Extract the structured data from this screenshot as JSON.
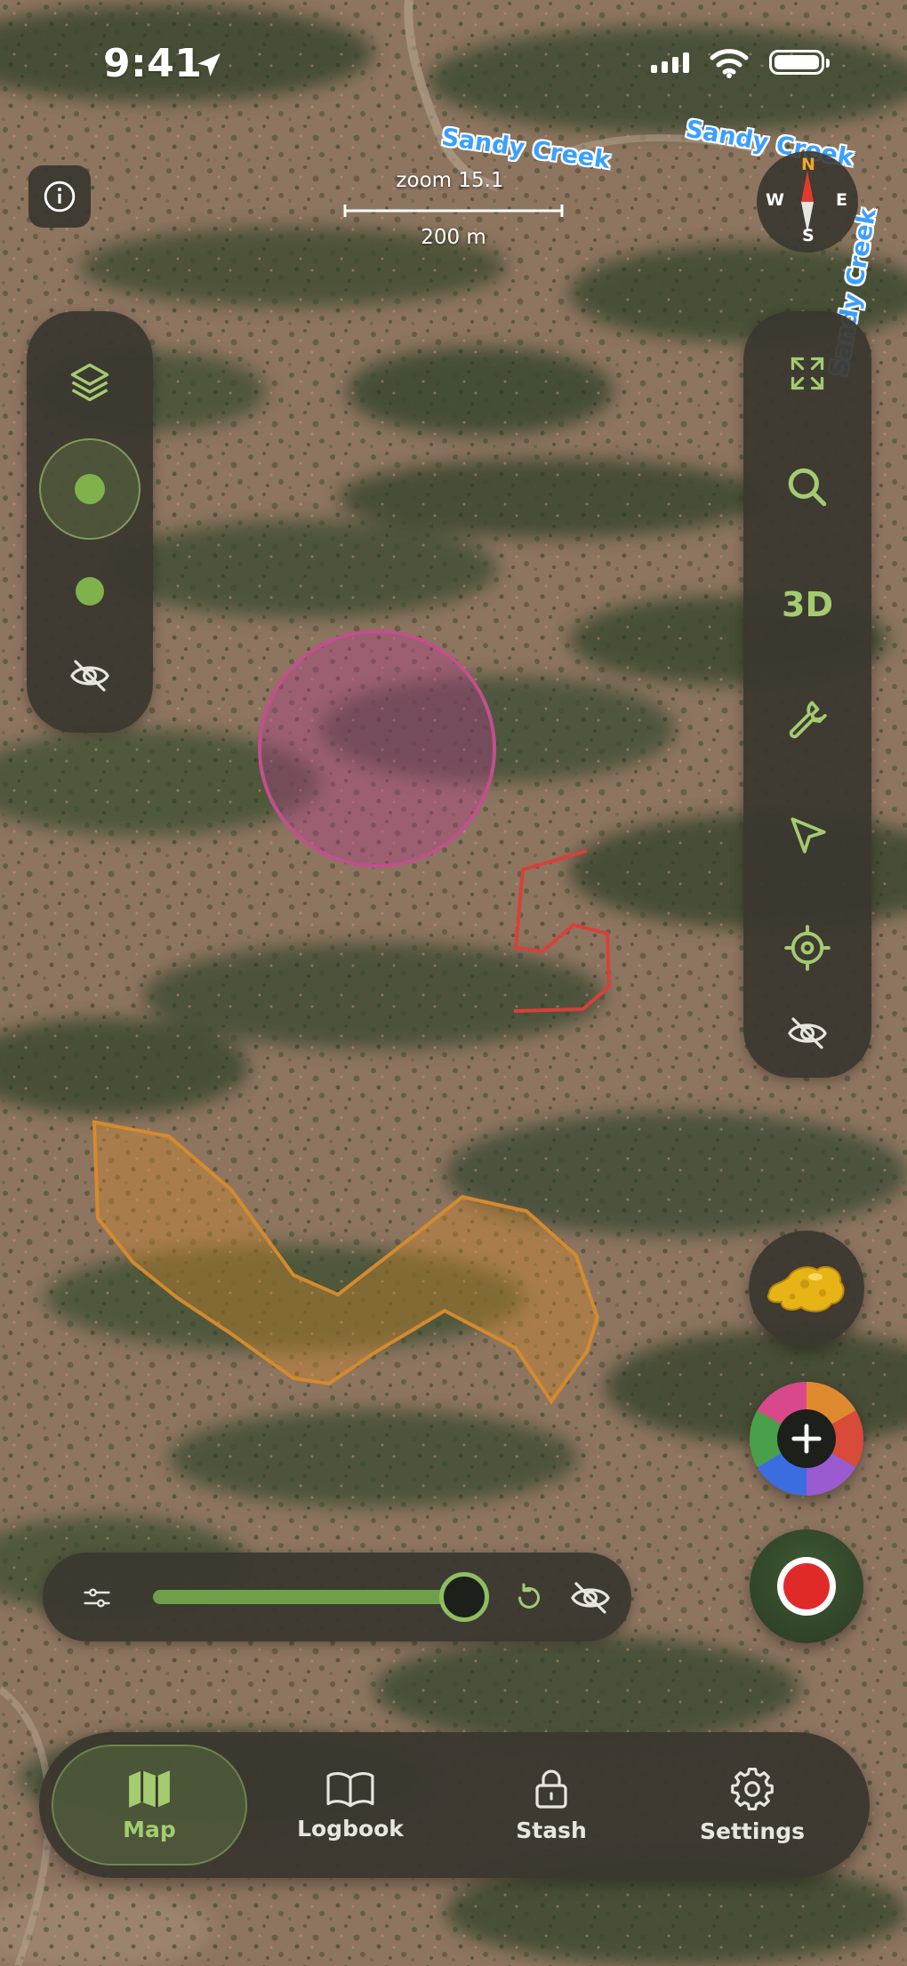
{
  "status_bar": {
    "time": "9:41"
  },
  "map": {
    "creek_labels": [
      "Sandy Creek",
      "Sandy Creek",
      "Sandy Creek"
    ],
    "zoom_label": "zoom 15.1",
    "scale_label": "200 m"
  },
  "compass": {
    "north": "N",
    "south": "S",
    "east": "E",
    "west": "W"
  },
  "left_panel": {
    "icons": [
      "layers-icon",
      "location-dot-icon",
      "dot-icon",
      "eye-off-icon"
    ]
  },
  "right_panel": {
    "three_d_label": "3D",
    "icons": [
      "expand-icon",
      "search-icon",
      "3d-toggle",
      "wrench-icon",
      "navigate-arrow-icon",
      "crosshair-icon",
      "eye-off-icon"
    ]
  },
  "opacity_slider": {
    "value": 1.0
  },
  "tabs": [
    {
      "label": "Map",
      "icon": "map-icon",
      "active": true
    },
    {
      "label": "Logbook",
      "icon": "book-icon",
      "active": false
    },
    {
      "label": "Stash",
      "icon": "lock-icon",
      "active": false
    },
    {
      "label": "Settings",
      "icon": "gear-icon",
      "active": false
    }
  ],
  "colors": {
    "accent": "#a3cc70",
    "panel": "#3a3730",
    "circle": "#c0508e",
    "path": "#d8403a",
    "polygon": "#d48a2e",
    "record": "#e02a2a",
    "creek": "#3aa0ff"
  }
}
